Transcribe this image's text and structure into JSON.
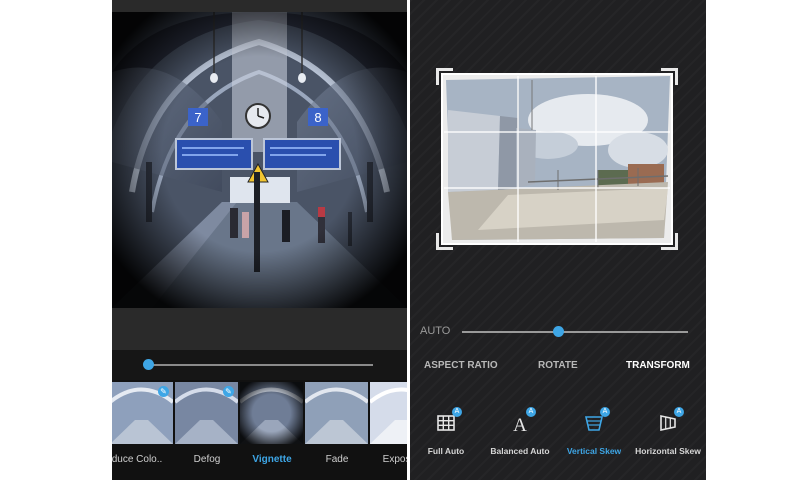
{
  "left_panel": {
    "photo": {
      "platform_numbers": [
        "7",
        "8"
      ]
    },
    "filters": [
      {
        "label": "duce Colo..",
        "active": false
      },
      {
        "label": "Defog",
        "active": false
      },
      {
        "label": "Vignette",
        "active": true
      },
      {
        "label": "Fade",
        "active": false
      },
      {
        "label": "Exposur",
        "active": false
      }
    ]
  },
  "right_panel": {
    "auto_label": "AUTO",
    "tabs": [
      "ASPECT RATIO",
      "ROTATE",
      "TRANSFORM"
    ],
    "active_tab": "TRANSFORM",
    "tools": [
      {
        "label": "Full Auto",
        "icon": "grid-icon",
        "active": false
      },
      {
        "label": "Balanced Auto",
        "icon": "letter-a-icon",
        "active": false
      },
      {
        "label": "Vertical Skew",
        "icon": "vertical-skew-icon",
        "active": true
      },
      {
        "label": "Horizontal Skew",
        "icon": "horizontal-skew-icon",
        "active": false
      }
    ]
  },
  "colors": {
    "accent": "#3ea6e6"
  }
}
